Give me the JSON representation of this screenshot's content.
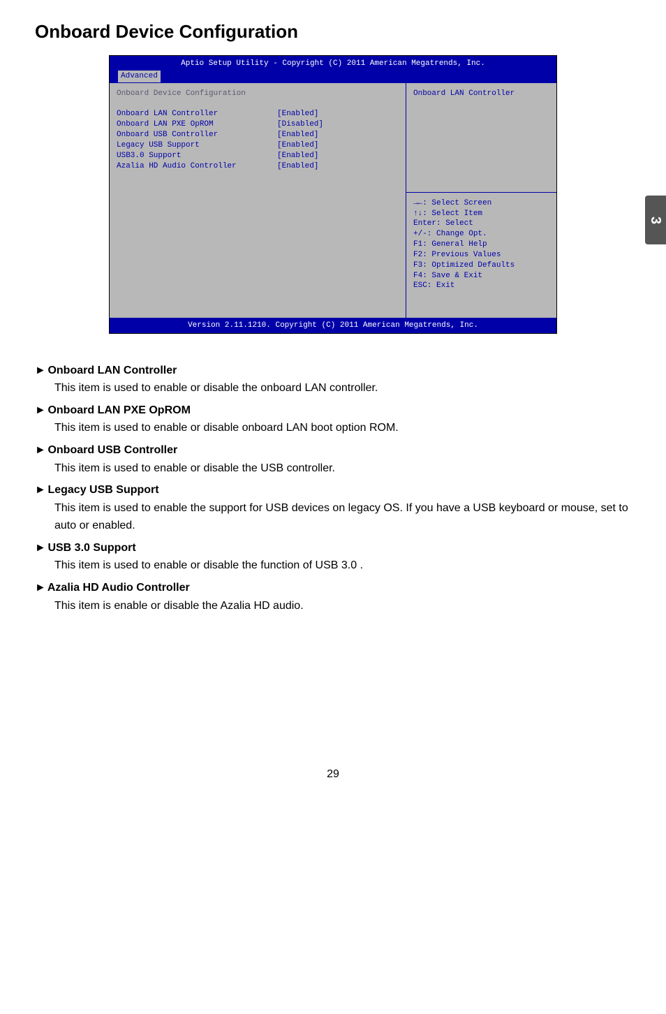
{
  "title": "Onboard Device Configuration",
  "side_tab": "3",
  "page_number": "29",
  "bios": {
    "header_title": "Aptio Setup Utility - Copyright (C) 2011 American Megatrends, Inc.",
    "tab": "Advanced",
    "left_heading": "Onboard Device Configuration",
    "rows": [
      {
        "label": "Onboard LAN Controller",
        "value": "[Enabled]"
      },
      {
        "label": "Onboard LAN PXE OpROM",
        "value": "[Disabled]"
      },
      {
        "label": "Onboard USB Controller",
        "value": "[Enabled]"
      },
      {
        "label": "Legacy USB Support",
        "value": "[Enabled]"
      },
      {
        "label": "USB3.0 Support",
        "value": "[Enabled]"
      },
      {
        "label": "Azalia HD Audio Controller",
        "value": "[Enabled]"
      }
    ],
    "right_top": "Onboard LAN Controller",
    "help": [
      "→←: Select Screen",
      "↑↓: Select Item",
      "Enter: Select",
      "+/-: Change Opt.",
      "F1: General Help",
      "F2: Previous Values",
      "F3: Optimized Defaults",
      "F4: Save & Exit",
      "ESC: Exit"
    ],
    "footer": "Version 2.11.1210. Copyright (C) 2011 American Megatrends, Inc."
  },
  "descriptions": [
    {
      "title": "Onboard LAN Controller",
      "body": "This item is used to enable or disable the onboard LAN controller."
    },
    {
      "title": "Onboard LAN PXE OpROM",
      "body": "This item is used to enable or disable onboard LAN boot option ROM."
    },
    {
      "title": "Onboard USB Controller",
      "body": "This item is used to enable or disable the USB controller."
    },
    {
      "title": "Legacy USB Support",
      "body": "This item is used to enable the support for USB devices on legacy OS. If you have a USB keyboard or mouse, set to auto or enabled."
    },
    {
      "title": "USB 3.0 Support",
      "body": "This item is used to enable or disable the function of USB 3.0 ."
    },
    {
      "title": "Azalia HD Audio Controller",
      "body": "This item is enable or disable the Azalia HD audio."
    }
  ]
}
